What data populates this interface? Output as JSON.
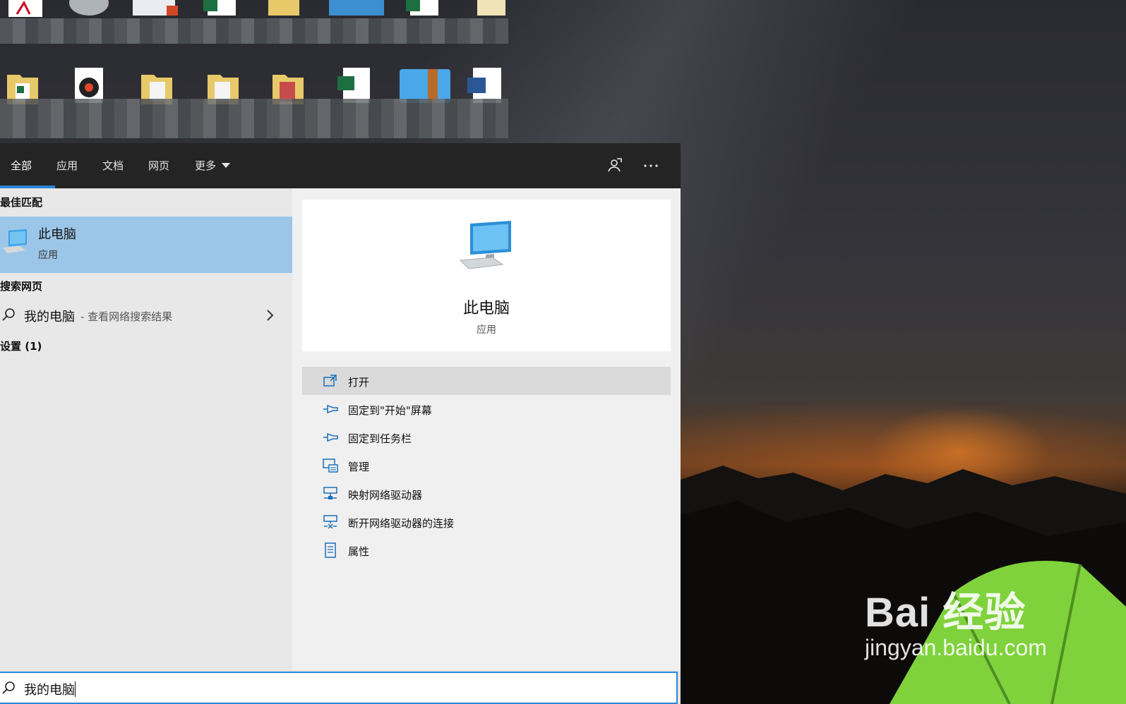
{
  "tabs": [
    {
      "label": "全部",
      "active": true
    },
    {
      "label": "应用"
    },
    {
      "label": "文档"
    },
    {
      "label": "网页"
    },
    {
      "label": "更多"
    }
  ],
  "toolbar_icons": [
    "feedback-icon",
    "more-options-icon"
  ],
  "sections": {
    "best_match": "最佳匹配",
    "search_web": "搜索网页",
    "settings": "设置 (1)"
  },
  "best_match_item": {
    "title": "此电脑",
    "subtitle": "应用"
  },
  "web_item": {
    "query": "我的电脑",
    "hint": "- 查看网络搜索结果"
  },
  "detail": {
    "name": "此电脑",
    "kind": "应用"
  },
  "actions": [
    {
      "label": "打开",
      "icon": "open-icon"
    },
    {
      "label": "固定到\"开始\"屏幕",
      "icon": "pin-icon"
    },
    {
      "label": "固定到任务栏",
      "icon": "pin-icon"
    },
    {
      "label": "管理",
      "icon": "manage-icon"
    },
    {
      "label": "映射网络驱动器",
      "icon": "map-network-drive-icon"
    },
    {
      "label": "断开网络驱动器的连接",
      "icon": "disconnect-network-drive-icon"
    },
    {
      "label": "属性",
      "icon": "properties-icon"
    }
  ],
  "search": {
    "value": "我的电脑"
  },
  "watermark": {
    "main": "Bai 经验",
    "sub": "jingyan.baidu.com"
  },
  "colors": {
    "accent": "#2a86d8",
    "selected": "#9cc6e8",
    "tabbar": "#242424"
  }
}
